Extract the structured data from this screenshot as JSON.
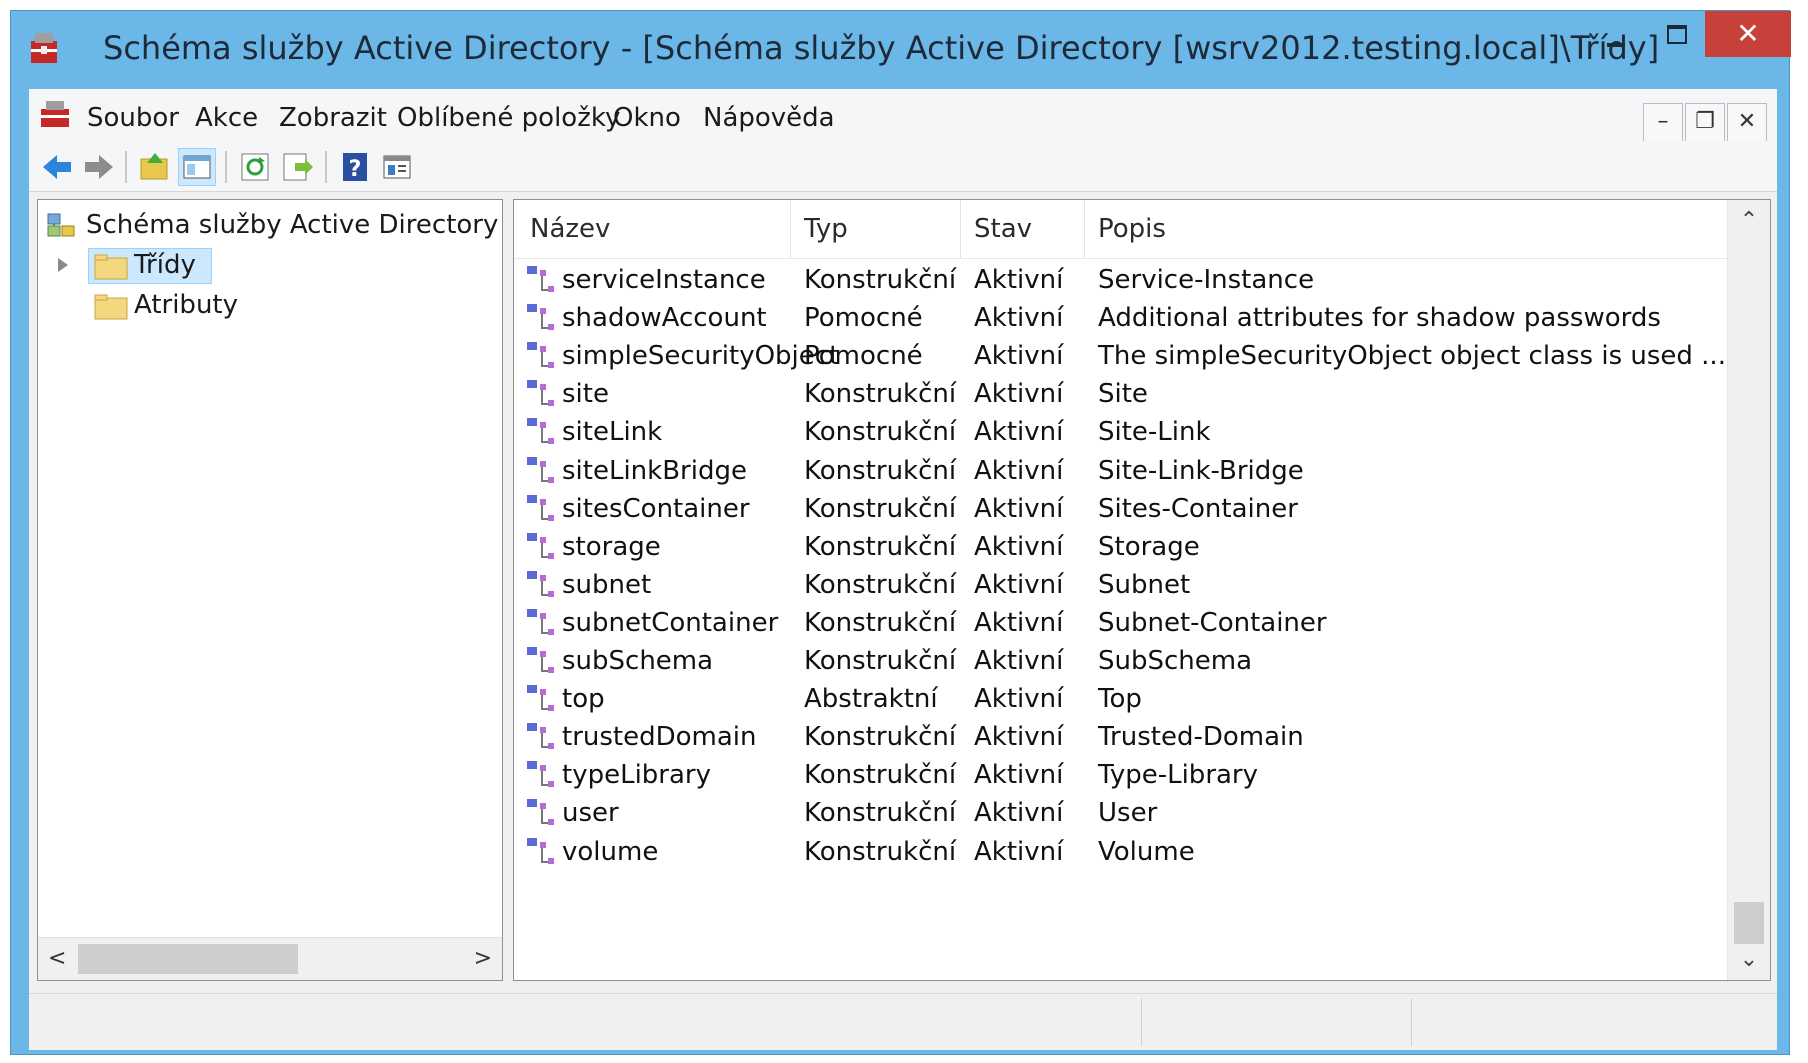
{
  "window": {
    "title": "Schéma služby Active Directory - [Schéma služby Active Directory [wsrv2012.testing.local]\\Třídy]",
    "controls": {
      "minimize": "minimize",
      "maximize": "maximize",
      "close": "✕"
    }
  },
  "menu": {
    "items": [
      "Soubor",
      "Akce",
      "Zobrazit",
      "Oblíbené položky",
      "Okno",
      "Nápověda"
    ],
    "mdi": {
      "minimize": "–",
      "restore": "❐",
      "close": "✕"
    }
  },
  "toolbar": {
    "buttons": [
      "back-icon",
      "forward-icon",
      "up-level-icon",
      "show-hide-tree-icon",
      "refresh-icon",
      "export-list-icon",
      "help-icon",
      "properties-icon"
    ]
  },
  "tree": {
    "root": "Schéma služby Active Directory",
    "items": [
      "Třídy",
      "Atributy"
    ],
    "selected": "Třídy"
  },
  "list": {
    "columns": [
      "Název",
      "Typ",
      "Stav",
      "Popis"
    ],
    "rows": [
      [
        "serviceInstance",
        "Konstrukční",
        "Aktivní",
        "Service-Instance"
      ],
      [
        "shadowAccount",
        "Pomocné",
        "Aktivní",
        "Additional attributes for shadow passwords"
      ],
      [
        "simpleSecurityObject",
        "Pomocné",
        "Aktivní",
        "The simpleSecurityObject object class is used ..."
      ],
      [
        "site",
        "Konstrukční",
        "Aktivní",
        "Site"
      ],
      [
        "siteLink",
        "Konstrukční",
        "Aktivní",
        "Site-Link"
      ],
      [
        "siteLinkBridge",
        "Konstrukční",
        "Aktivní",
        "Site-Link-Bridge"
      ],
      [
        "sitesContainer",
        "Konstrukční",
        "Aktivní",
        "Sites-Container"
      ],
      [
        "storage",
        "Konstrukční",
        "Aktivní",
        "Storage"
      ],
      [
        "subnet",
        "Konstrukční",
        "Aktivní",
        "Subnet"
      ],
      [
        "subnetContainer",
        "Konstrukční",
        "Aktivní",
        "Subnet-Container"
      ],
      [
        "subSchema",
        "Konstrukční",
        "Aktivní",
        "SubSchema"
      ],
      [
        "top",
        "Abstraktní",
        "Aktivní",
        "Top"
      ],
      [
        "trustedDomain",
        "Konstrukční",
        "Aktivní",
        "Trusted-Domain"
      ],
      [
        "typeLibrary",
        "Konstrukční",
        "Aktivní",
        "Type-Library"
      ],
      [
        "user",
        "Konstrukční",
        "Aktivní",
        "User"
      ],
      [
        "volume",
        "Konstrukční",
        "Aktivní",
        "Volume"
      ]
    ]
  },
  "colors": {
    "titlebar": "#6ab7e8",
    "close_button": "#c8403a",
    "selection": "#cce8ff",
    "class_icon": "#5a6bd6"
  }
}
